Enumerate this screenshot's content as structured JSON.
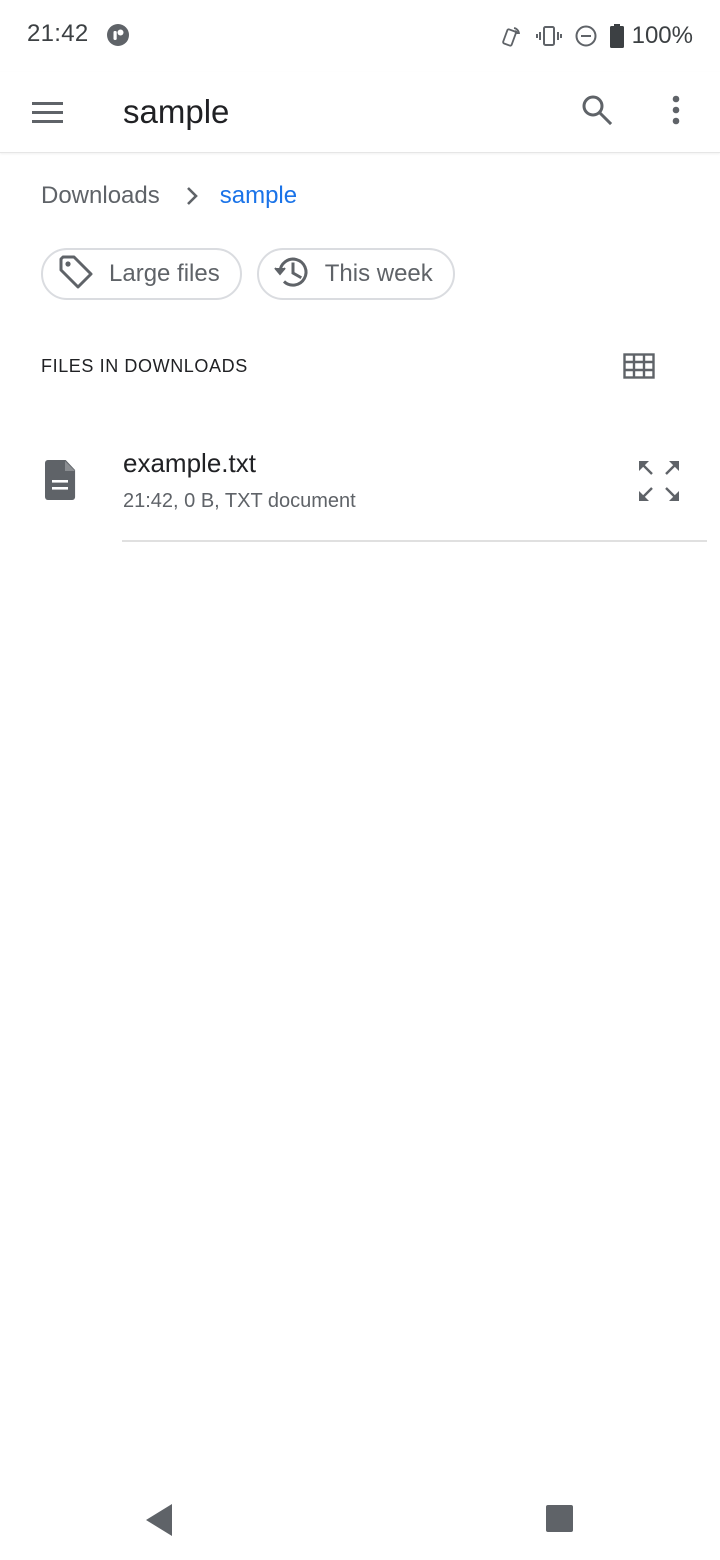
{
  "status_bar": {
    "time": "21:42",
    "battery_percent": "100%",
    "icons": [
      "app-notification-icon",
      "nfc-icon",
      "vibrate-icon",
      "do-not-disturb-icon",
      "battery-icon"
    ]
  },
  "app_bar": {
    "title": "sample",
    "icons": [
      "hamburger-menu-icon",
      "search-icon",
      "more-vert-icon"
    ]
  },
  "breadcrumb": {
    "root": "Downloads",
    "current": "sample"
  },
  "chips": [
    {
      "label": "Large files",
      "icon": "tag-icon"
    },
    {
      "label": "This week",
      "icon": "history-icon"
    }
  ],
  "section": {
    "header": "FILES IN DOWNLOADS",
    "view_toggle_icon": "grid-view-icon"
  },
  "files": [
    {
      "name": "example.txt",
      "meta": "21:42, 0 B, TXT document",
      "icon": "document-icon",
      "action_icon": "expand-preview-icon"
    }
  ],
  "colors": {
    "accent": "#1a73e8",
    "icon_gray": "#5f6368",
    "text_primary": "#202124",
    "divider": "#e0e0e0"
  }
}
